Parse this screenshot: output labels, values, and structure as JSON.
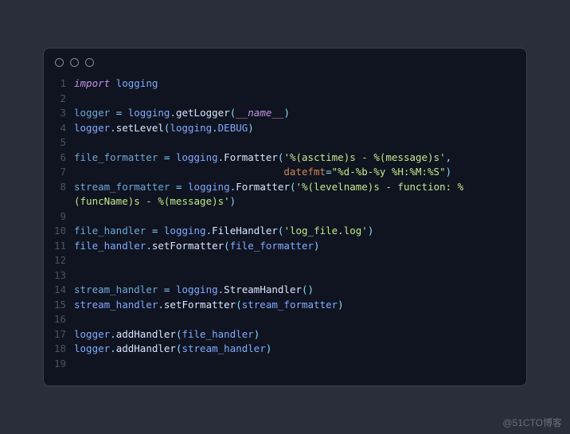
{
  "watermark": "@51CTO博客",
  "lines": [
    {
      "n": "1",
      "tokens": [
        [
          "kw-import",
          "import"
        ],
        [
          "",
          " "
        ],
        [
          "ident",
          "logging"
        ]
      ]
    },
    {
      "n": "2",
      "tokens": []
    },
    {
      "n": "3",
      "tokens": [
        [
          "assign",
          "logger"
        ],
        [
          "",
          " "
        ],
        [
          "eq",
          "="
        ],
        [
          "",
          " "
        ],
        [
          "ident",
          "logging"
        ],
        [
          "punct",
          "."
        ],
        [
          "method",
          "getLogger"
        ],
        [
          "punct",
          "("
        ],
        [
          "dunder",
          "__name__"
        ],
        [
          "punct",
          ")"
        ]
      ]
    },
    {
      "n": "4",
      "tokens": [
        [
          "ident",
          "logger"
        ],
        [
          "punct",
          "."
        ],
        [
          "method",
          "setLevel"
        ],
        [
          "punct",
          "("
        ],
        [
          "ident",
          "logging"
        ],
        [
          "punct",
          "."
        ],
        [
          "ident",
          "DEBUG"
        ],
        [
          "punct",
          ")"
        ]
      ]
    },
    {
      "n": "5",
      "tokens": []
    },
    {
      "n": "6",
      "tokens": [
        [
          "assign",
          "file_formatter"
        ],
        [
          "",
          " "
        ],
        [
          "eq",
          "="
        ],
        [
          "",
          " "
        ],
        [
          "ident",
          "logging"
        ],
        [
          "punct",
          "."
        ],
        [
          "method",
          "Formatter"
        ],
        [
          "punct",
          "("
        ],
        [
          "string",
          "'%(asctime)s - %(message)s'"
        ],
        [
          "punct",
          ","
        ]
      ]
    },
    {
      "n": "7",
      "tokens": [
        [
          "",
          "                                   "
        ],
        [
          "kwarg",
          "datefmt"
        ],
        [
          "eq",
          "="
        ],
        [
          "string",
          "\"%d-%b-%y %H:%M:%S\""
        ],
        [
          "punct",
          ")"
        ]
      ]
    },
    {
      "n": "8",
      "tokens": [
        [
          "assign",
          "stream_formatter"
        ],
        [
          "",
          " "
        ],
        [
          "eq",
          "="
        ],
        [
          "",
          " "
        ],
        [
          "ident",
          "logging"
        ],
        [
          "punct",
          "."
        ],
        [
          "method",
          "Formatter"
        ],
        [
          "punct",
          "("
        ],
        [
          "string",
          "'%(levelname)s - function: %(funcName)s - %(message)s'"
        ],
        [
          "punct",
          ")"
        ]
      ]
    },
    {
      "n": "9",
      "tokens": []
    },
    {
      "n": "10",
      "tokens": [
        [
          "assign",
          "file_handler"
        ],
        [
          "",
          " "
        ],
        [
          "eq",
          "="
        ],
        [
          "",
          " "
        ],
        [
          "ident",
          "logging"
        ],
        [
          "punct",
          "."
        ],
        [
          "method",
          "FileHandler"
        ],
        [
          "punct",
          "("
        ],
        [
          "string",
          "'log_file.log'"
        ],
        [
          "punct",
          ")"
        ]
      ]
    },
    {
      "n": "11",
      "tokens": [
        [
          "ident",
          "file_handler"
        ],
        [
          "punct",
          "."
        ],
        [
          "method",
          "setFormatter"
        ],
        [
          "punct",
          "("
        ],
        [
          "ident",
          "file_formatter"
        ],
        [
          "punct",
          ")"
        ]
      ]
    },
    {
      "n": "12",
      "tokens": []
    },
    {
      "n": "13",
      "tokens": []
    },
    {
      "n": "14",
      "tokens": [
        [
          "assign",
          "stream_handler"
        ],
        [
          "",
          " "
        ],
        [
          "eq",
          "="
        ],
        [
          "",
          " "
        ],
        [
          "ident",
          "logging"
        ],
        [
          "punct",
          "."
        ],
        [
          "method",
          "StreamHandler"
        ],
        [
          "punct",
          "("
        ],
        [
          "punct",
          ")"
        ]
      ]
    },
    {
      "n": "15",
      "tokens": [
        [
          "ident",
          "stream_handler"
        ],
        [
          "punct",
          "."
        ],
        [
          "method",
          "setFormatter"
        ],
        [
          "punct",
          "("
        ],
        [
          "ident",
          "stream_formatter"
        ],
        [
          "punct",
          ")"
        ]
      ]
    },
    {
      "n": "16",
      "tokens": []
    },
    {
      "n": "17",
      "tokens": [
        [
          "ident",
          "logger"
        ],
        [
          "punct",
          "."
        ],
        [
          "method",
          "addHandler"
        ],
        [
          "punct",
          "("
        ],
        [
          "ident",
          "file_handler"
        ],
        [
          "punct",
          ")"
        ]
      ]
    },
    {
      "n": "18",
      "tokens": [
        [
          "ident",
          "logger"
        ],
        [
          "punct",
          "."
        ],
        [
          "method",
          "addHandler"
        ],
        [
          "punct",
          "("
        ],
        [
          "ident",
          "stream_handler"
        ],
        [
          "punct",
          ")"
        ]
      ]
    },
    {
      "n": "19",
      "tokens": []
    }
  ]
}
